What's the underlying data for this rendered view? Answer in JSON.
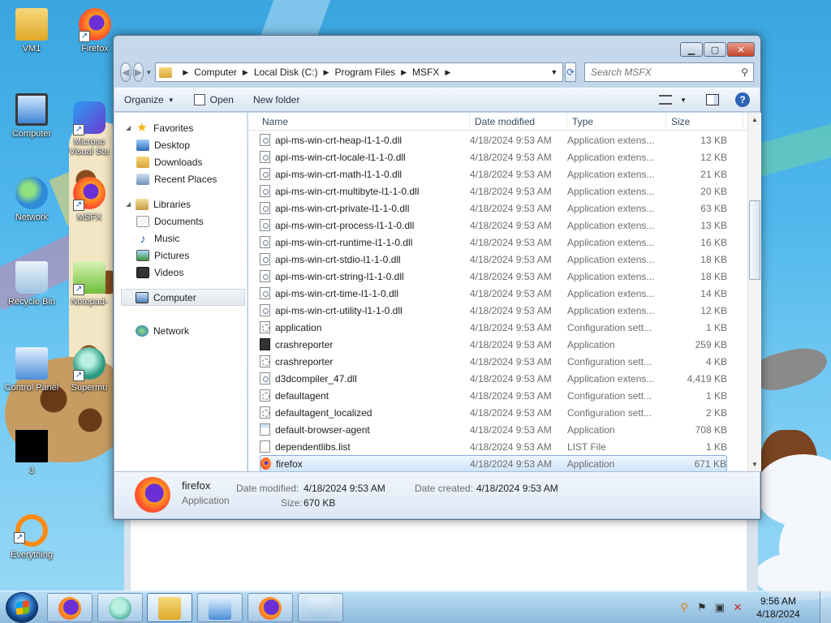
{
  "desktop": {
    "icons": [
      {
        "label": "VM1"
      },
      {
        "label": "Firefox"
      },
      {
        "label": "Computer"
      },
      {
        "label": "Microso Visual Stu"
      },
      {
        "label": "Network"
      },
      {
        "label": "MSFX"
      },
      {
        "label": "Recycle Bin"
      },
      {
        "label": "Notepad-"
      },
      {
        "label": "Control Panel"
      },
      {
        "label": "Supermu"
      },
      {
        "label": "3"
      },
      {
        "label": "Everything"
      }
    ]
  },
  "explorer": {
    "breadcrumb": [
      "Computer",
      "Local Disk (C:)",
      "Program Files",
      "MSFX"
    ],
    "search_placeholder": "Search MSFX",
    "toolbar": {
      "organize": "Organize",
      "open": "Open",
      "new_folder": "New folder"
    },
    "nav": {
      "favorites": {
        "label": "Favorites",
        "items": [
          "Desktop",
          "Downloads",
          "Recent Places"
        ]
      },
      "libraries": {
        "label": "Libraries",
        "items": [
          "Documents",
          "Music",
          "Pictures",
          "Videos"
        ]
      },
      "computer": "Computer",
      "network": "Network"
    },
    "columns": {
      "name": "Name",
      "date": "Date modified",
      "type": "Type",
      "size": "Size"
    },
    "files": [
      {
        "name": "api-ms-win-crt-heap-l1-1-0.dll",
        "date": "4/18/2024 9:53 AM",
        "type": "Application extens...",
        "size": "13 KB",
        "kind": "dll"
      },
      {
        "name": "api-ms-win-crt-locale-l1-1-0.dll",
        "date": "4/18/2024 9:53 AM",
        "type": "Application extens...",
        "size": "12 KB",
        "kind": "dll"
      },
      {
        "name": "api-ms-win-crt-math-l1-1-0.dll",
        "date": "4/18/2024 9:53 AM",
        "type": "Application extens...",
        "size": "21 KB",
        "kind": "dll"
      },
      {
        "name": "api-ms-win-crt-multibyte-l1-1-0.dll",
        "date": "4/18/2024 9:53 AM",
        "type": "Application extens...",
        "size": "20 KB",
        "kind": "dll"
      },
      {
        "name": "api-ms-win-crt-private-l1-1-0.dll",
        "date": "4/18/2024 9:53 AM",
        "type": "Application extens...",
        "size": "63 KB",
        "kind": "dll"
      },
      {
        "name": "api-ms-win-crt-process-l1-1-0.dll",
        "date": "4/18/2024 9:53 AM",
        "type": "Application extens...",
        "size": "13 KB",
        "kind": "dll"
      },
      {
        "name": "api-ms-win-crt-runtime-l1-1-0.dll",
        "date": "4/18/2024 9:53 AM",
        "type": "Application extens...",
        "size": "16 KB",
        "kind": "dll"
      },
      {
        "name": "api-ms-win-crt-stdio-l1-1-0.dll",
        "date": "4/18/2024 9:53 AM",
        "type": "Application extens...",
        "size": "18 KB",
        "kind": "dll"
      },
      {
        "name": "api-ms-win-crt-string-l1-1-0.dll",
        "date": "4/18/2024 9:53 AM",
        "type": "Application extens...",
        "size": "18 KB",
        "kind": "dll"
      },
      {
        "name": "api-ms-win-crt-time-l1-1-0.dll",
        "date": "4/18/2024 9:53 AM",
        "type": "Application extens...",
        "size": "14 KB",
        "kind": "dll"
      },
      {
        "name": "api-ms-win-crt-utility-l1-1-0.dll",
        "date": "4/18/2024 9:53 AM",
        "type": "Application extens...",
        "size": "12 KB",
        "kind": "dll"
      },
      {
        "name": "application",
        "date": "4/18/2024 9:53 AM",
        "type": "Configuration sett...",
        "size": "1 KB",
        "kind": "cfg"
      },
      {
        "name": "crashreporter",
        "date": "4/18/2024 9:53 AM",
        "type": "Application",
        "size": "259 KB",
        "kind": "crash"
      },
      {
        "name": "crashreporter",
        "date": "4/18/2024 9:53 AM",
        "type": "Configuration sett...",
        "size": "4 KB",
        "kind": "cfg"
      },
      {
        "name": "d3dcompiler_47.dll",
        "date": "4/18/2024 9:53 AM",
        "type": "Application extens...",
        "size": "4,419 KB",
        "kind": "dll"
      },
      {
        "name": "defaultagent",
        "date": "4/18/2024 9:53 AM",
        "type": "Configuration sett...",
        "size": "1 KB",
        "kind": "cfg"
      },
      {
        "name": "defaultagent_localized",
        "date": "4/18/2024 9:53 AM",
        "type": "Configuration sett...",
        "size": "2 KB",
        "kind": "cfg"
      },
      {
        "name": "default-browser-agent",
        "date": "4/18/2024 9:53 AM",
        "type": "Application",
        "size": "708 KB",
        "kind": "app"
      },
      {
        "name": "dependentlibs.list",
        "date": "4/18/2024 9:53 AM",
        "type": "LIST File",
        "size": "1 KB",
        "kind": "list"
      },
      {
        "name": "firefox",
        "date": "4/18/2024 9:53 AM",
        "type": "Application",
        "size": "671 KB",
        "kind": "fox",
        "selected": true
      }
    ],
    "details": {
      "name": "firefox",
      "type": "Application",
      "date_modified_label": "Date modified:",
      "date_modified": "4/18/2024 9:53 AM",
      "date_created_label": "Date created:",
      "date_created": "4/18/2024 9:53 AM",
      "size_label": "Size:",
      "size": "670 KB"
    }
  },
  "taskbar": {
    "clock_time": "9:56 AM",
    "clock_date": "4/18/2024"
  }
}
